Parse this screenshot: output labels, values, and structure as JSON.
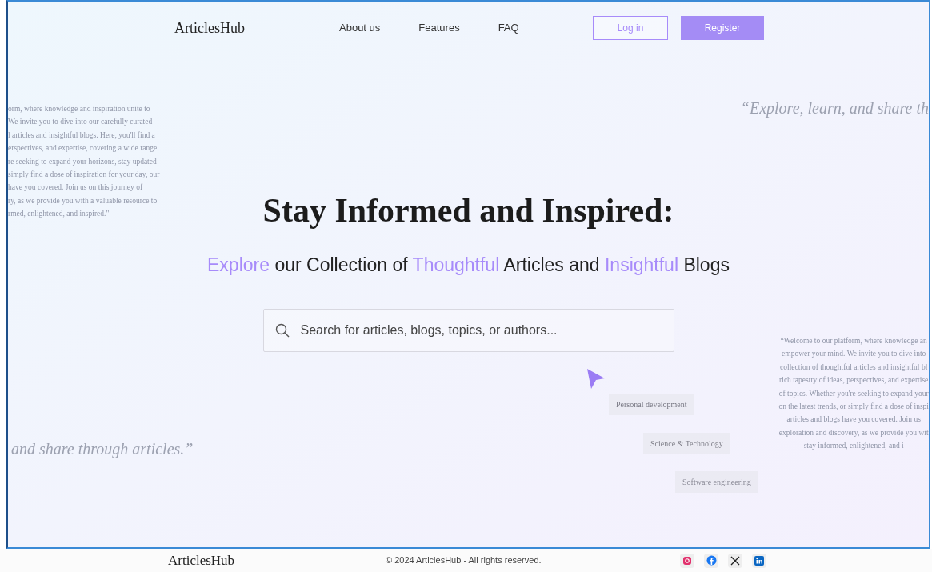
{
  "nav": {
    "logo": "ArticlesHub",
    "links": [
      "About us",
      "Features",
      "FAQ"
    ],
    "login": "Log in",
    "register": "Register"
  },
  "hero": {
    "title": "Stay Informed and Inspired:",
    "subtitle": "*Explore* our Collection of *Thoughtful* Articles and *Insightful* Blogs",
    "search": {
      "placeholder": "Search for articles, blogs, topics, or authors..."
    }
  },
  "background": {
    "left_paragraph": [
      "orm, where knowledge and inspiration unite to",
      "We invite you to dive into our carefully curated",
      "l articles and insightful blogs. Here, you'll find a",
      "erspectives, and expertise, covering a wide range",
      "re seeking to expand your horizons, stay updated",
      "simply find a dose of inspiration for your day, our",
      "have you covered. Join us on this journey of",
      "ry, as we provide you with a valuable resource to",
      "rmed, enlightened, and inspired.\""
    ],
    "right_paragraph": [
      "“Welcome to our platform, where knowledge an",
      "empower your mind. We invite you to dive into",
      "collection of thoughtful articles and insightful bl",
      "rich tapestry of ideas, perspectives, and expertise",
      "of topics. Whether you're seeking to expand your",
      "on the latest trends, or simply find a dose of inspi",
      "articles and blogs have you covered. Join us",
      "exploration and discovery, as we provide you wit",
      "stay informed, enlightened, and i"
    ],
    "quote_top": "“Explore, learn, and share th",
    "quote_bottom": "and share through articles.”",
    "tags": [
      "Personal development",
      "Science & Technology",
      "Software engineering"
    ]
  },
  "footer": {
    "logo": "ArticlesHub",
    "copyright": "© 2024 ArticlesHub - All rights reserved."
  }
}
